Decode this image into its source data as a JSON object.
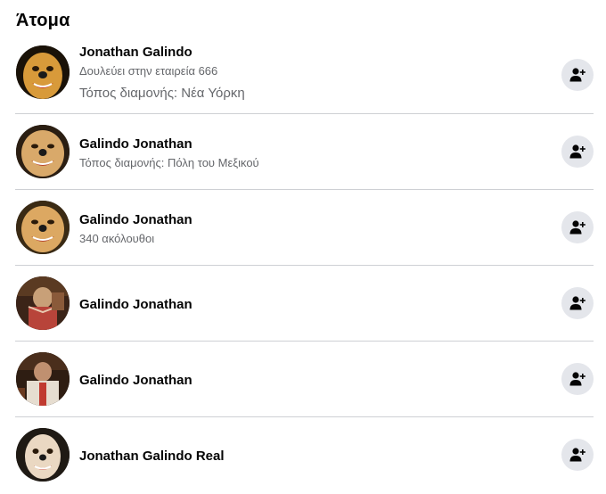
{
  "section": {
    "title": "Άτομα"
  },
  "people": [
    {
      "name": "Jonathan Galindo",
      "line1": "Δουλεύει στην εταιρεία 666",
      "line2": "Τόπος διαμονής: Νέα Υόρκη"
    },
    {
      "name": "Galindo Jonathan",
      "line1": "Τόπος διαμονής: Πόλη του Μεξικού"
    },
    {
      "name": "Galindo Jonathan",
      "line1": "340 ακόλουθοι"
    },
    {
      "name": "Galindo Jonathan"
    },
    {
      "name": "Galindo Jonathan"
    },
    {
      "name": "Jonathan Galindo Real"
    }
  ],
  "colors": {
    "button_bg": "#e4e6eb",
    "icon": "#050505",
    "secondary_text": "#65676b",
    "divider": "#ced0d4"
  },
  "icons": {
    "add_friend": "add-friend-icon"
  }
}
